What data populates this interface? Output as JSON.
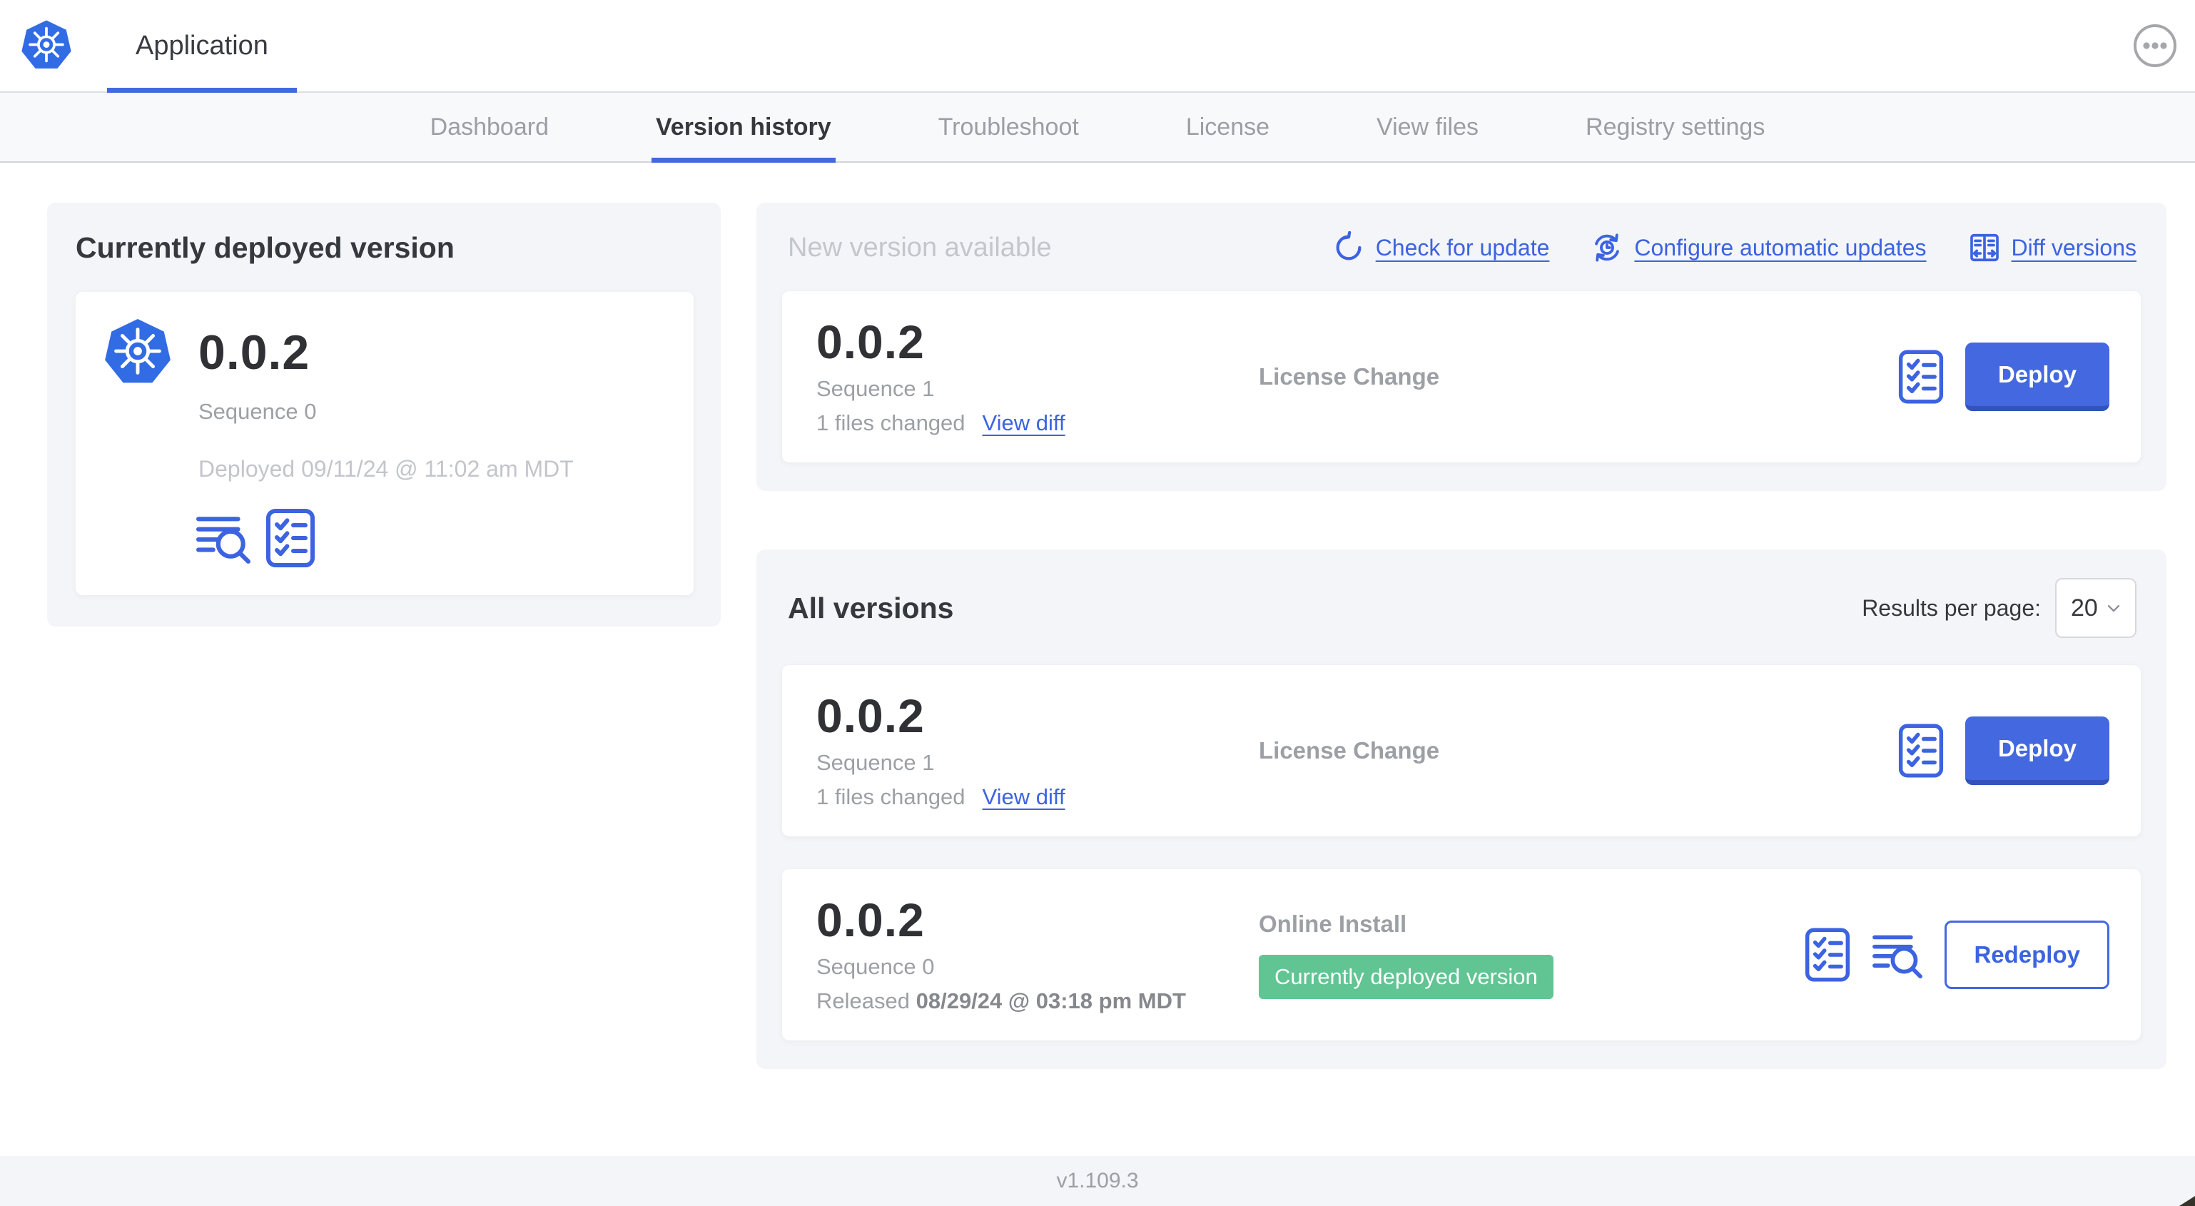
{
  "colors": {
    "accent_blue": "#4368e0",
    "k8s_blue": "#326ce5",
    "badge_green": "#61c493",
    "panel_gray": "#f4f5f8",
    "muted_text": "#9ca0a5"
  },
  "header": {
    "title": "Application"
  },
  "nav": {
    "active_tab": "Version history",
    "tabs": [
      {
        "label": "Dashboard"
      },
      {
        "label": "Version history"
      },
      {
        "label": "Troubleshoot"
      },
      {
        "label": "License"
      },
      {
        "label": "View files"
      },
      {
        "label": "Registry settings"
      }
    ]
  },
  "current": {
    "heading": "Currently deployed version",
    "version": "0.0.2",
    "sequence": "Sequence 0",
    "deployed": "Deployed 09/11/24 @ 11:02 am MDT"
  },
  "new_version": {
    "heading": "New version available",
    "actions": [
      {
        "label": "Check for update",
        "icon": "refresh-icon"
      },
      {
        "label": "Configure automatic updates",
        "icon": "auto-update-clock-icon"
      },
      {
        "label": "Diff versions",
        "icon": "diff-columns-icon"
      }
    ],
    "row": {
      "version": "0.0.2",
      "sequence": "Sequence 1",
      "files_changed": "1 files changed",
      "view_diff": "View diff",
      "source": "License Change",
      "action": "Deploy"
    }
  },
  "all_versions": {
    "heading": "All versions",
    "results_label": "Results per page:",
    "results_value": "20",
    "rows": [
      {
        "version": "0.0.2",
        "sequence": "Sequence 1",
        "files_changed": "1 files changed",
        "view_diff": "View diff",
        "source": "License Change",
        "action": "Deploy"
      },
      {
        "version": "0.0.2",
        "sequence": "Sequence 0",
        "released_prefix": "Released",
        "released_date": "08/29/24 @ 03:18 pm MDT",
        "source": "Online Install",
        "badge": "Currently deployed version",
        "action": "Redeploy"
      }
    ]
  },
  "footer": {
    "app_version": "v1.109.3"
  },
  "icons": {
    "logo": "kubernetes-logo",
    "menu": "ellipsis-menu-icon",
    "logs": "view-logs-icon",
    "checklist": "preflight-checklist-icon",
    "chevron": "chevron-down-icon"
  }
}
